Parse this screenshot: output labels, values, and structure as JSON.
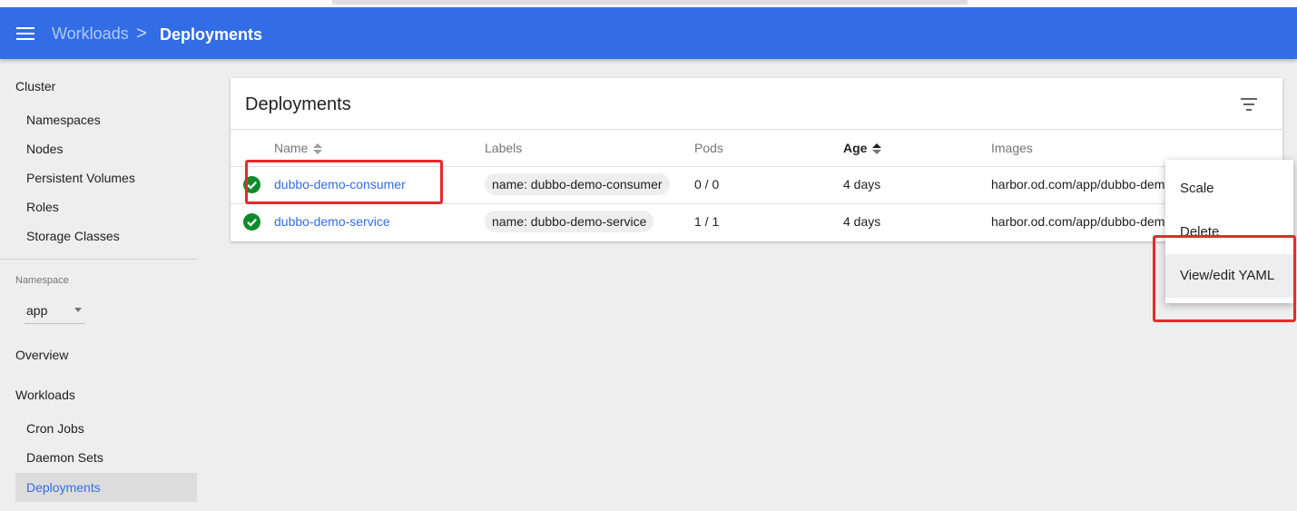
{
  "breadcrumb": {
    "parent": "Workloads",
    "separator": ">",
    "current": "Deployments"
  },
  "sidebar": {
    "cluster_heading": "Cluster",
    "cluster_items": [
      "Namespaces",
      "Nodes",
      "Persistent Volumes",
      "Roles",
      "Storage Classes"
    ],
    "namespace_label": "Namespace",
    "namespace_value": "app",
    "overview": "Overview",
    "workloads_heading": "Workloads",
    "workload_items": [
      "Cron Jobs",
      "Daemon Sets",
      "Deployments"
    ],
    "active_item": "Deployments"
  },
  "card": {
    "title": "Deployments",
    "columns": {
      "name": "Name",
      "labels": "Labels",
      "pods": "Pods",
      "age": "Age",
      "images": "Images"
    },
    "rows": [
      {
        "status": "ok",
        "name": "dubbo-demo-consumer",
        "label": "name: dubbo-demo-consumer",
        "pods": "0 / 0",
        "age": "4 days",
        "image": "harbor.od.com/app/dubbo-demo-consumer"
      },
      {
        "status": "ok",
        "name": "dubbo-demo-service",
        "label": "name: dubbo-demo-service",
        "pods": "1 / 1",
        "age": "4 days",
        "image": "harbor.od.com/app/dubbo-demo-service"
      }
    ]
  },
  "context_menu": {
    "items": [
      "Scale",
      "Delete",
      "View/edit YAML"
    ],
    "highlighted": "View/edit YAML"
  },
  "colors": {
    "appbar": "#326de6",
    "success": "#0e8a2a",
    "annotation": "#e52b2b"
  },
  "icons": {
    "menu": "hamburger-menu-icon",
    "filter": "filter-icon",
    "status": "check-circle-icon",
    "sort": "sort-icon"
  }
}
